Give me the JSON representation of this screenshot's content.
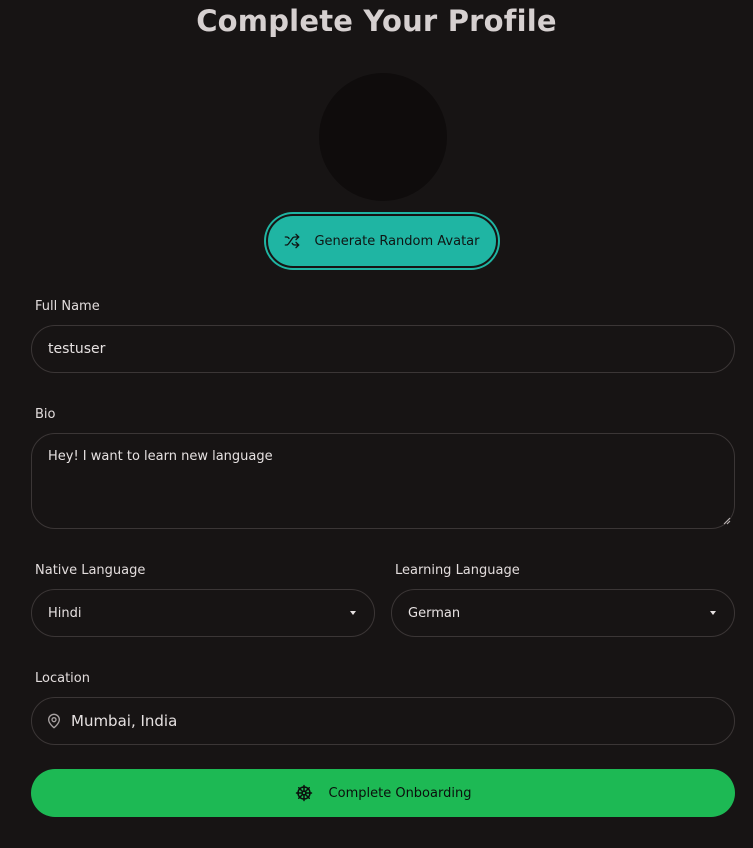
{
  "page": {
    "title": "Complete Your Profile"
  },
  "avatar": {
    "button_label": "Generate Random Avatar",
    "button_icon": "shuffle-icon"
  },
  "form": {
    "full_name": {
      "label": "Full Name",
      "value": "testuser"
    },
    "bio": {
      "label": "Bio",
      "value": "Hey! I want to learn new language"
    },
    "native_language": {
      "label": "Native Language",
      "selected": "Hindi"
    },
    "learning_language": {
      "label": "Learning Language",
      "selected": "German"
    },
    "location": {
      "label": "Location",
      "value": "Mumbai, India",
      "icon": "map-pin-icon"
    }
  },
  "submit": {
    "label": "Complete Onboarding",
    "icon": "ship-wheel-icon"
  },
  "colors": {
    "background": "#171414",
    "avatar_button": "#1fb5a3",
    "submit_button": "#1db954",
    "field_border": "#3b3636"
  }
}
